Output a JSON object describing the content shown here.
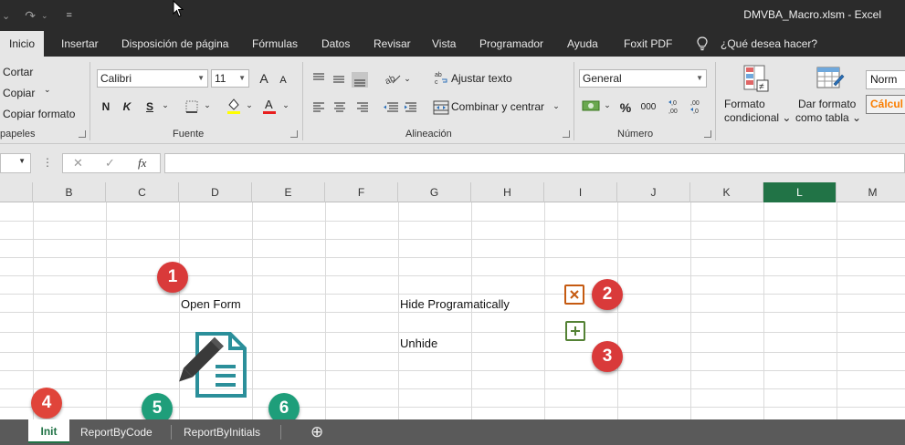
{
  "window": {
    "title": "DMVBA_Macro.xlsm  -  Excel"
  },
  "quick_access": {
    "undo_dropdown": "⌄",
    "redo": "↷",
    "customize": "="
  },
  "ribbon_tabs": [
    {
      "label": "Inicio",
      "active": true
    },
    {
      "label": "Insertar"
    },
    {
      "label": "Disposición de página"
    },
    {
      "label": "Fórmulas"
    },
    {
      "label": "Datos"
    },
    {
      "label": "Revisar"
    },
    {
      "label": "Vista"
    },
    {
      "label": "Programador"
    },
    {
      "label": "Ayuda"
    },
    {
      "label": "Foxit PDF"
    }
  ],
  "tell_me": "¿Qué desea hacer?",
  "clipboard": {
    "cut": "Cortar",
    "copy": "Copiar",
    "format_painter": "Copiar formato",
    "group_label": "papeles"
  },
  "font": {
    "name": "Calibri",
    "size": "11",
    "grow": "A",
    "shrink": "A",
    "bold": "N",
    "italic": "K",
    "underline": "S",
    "group_label": "Fuente"
  },
  "alignment": {
    "wrap_text": "Ajustar texto",
    "merge_center": "Combinar y centrar",
    "group_label": "Alineación"
  },
  "number": {
    "format": "General",
    "percent": "%",
    "thousands": "000",
    "inc_decimal": "←,0\n,00",
    "dec_decimal": ",00\n→,0",
    "group_label": "Número"
  },
  "styles": {
    "conditional_line1": "Formato",
    "conditional_line2": "condicional",
    "table_line1": "Dar formato",
    "table_line2": "como tabla",
    "style_normal": "Norm",
    "style_calc": "Cálcul"
  },
  "formula_bar": {
    "cancel": "✕",
    "enter": "✓",
    "fx": "fx",
    "value": ""
  },
  "columns": [
    "B",
    "C",
    "D",
    "E",
    "F",
    "G",
    "H",
    "I",
    "J",
    "K",
    "L",
    "M"
  ],
  "selected_column": "L",
  "cells": {
    "open_form": "Open Form",
    "hide_programatically": "Hide Programatically",
    "unhide": "Unhide"
  },
  "callouts": [
    {
      "n": "1",
      "color": "#d93a3a"
    },
    {
      "n": "2",
      "color": "#d93a3a"
    },
    {
      "n": "3",
      "color": "#d93a3a"
    },
    {
      "n": "4",
      "color": "#e0443a"
    },
    {
      "n": "5",
      "color": "#1e9e7a"
    },
    {
      "n": "6",
      "color": "#1e9e7a"
    }
  ],
  "sheets": [
    {
      "label": "Init",
      "active": true
    },
    {
      "label": "ReportByCode"
    },
    {
      "label": "ReportByInitials"
    }
  ],
  "add_sheet": "⊕",
  "colors": {
    "excel_green": "#217346",
    "hide_icon": "#c55a11",
    "unhide_icon": "#548235",
    "form_icon": "#2b8f9a"
  }
}
